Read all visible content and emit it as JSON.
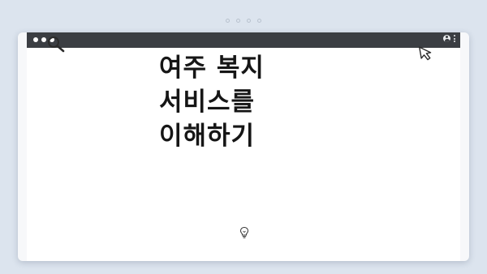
{
  "slide": {
    "title_lines": [
      "여주 복지",
      "서비스를",
      "이해하기"
    ]
  },
  "icons": {
    "search": "search-icon",
    "cursor": "cursor-arrow-icon",
    "bulb": "lightbulb-icon",
    "user": "user-icon",
    "menu": "kebab-menu-icon"
  },
  "colors": {
    "background": "#dce4ee",
    "titlebar": "#3b3e43",
    "text": "#161616"
  }
}
